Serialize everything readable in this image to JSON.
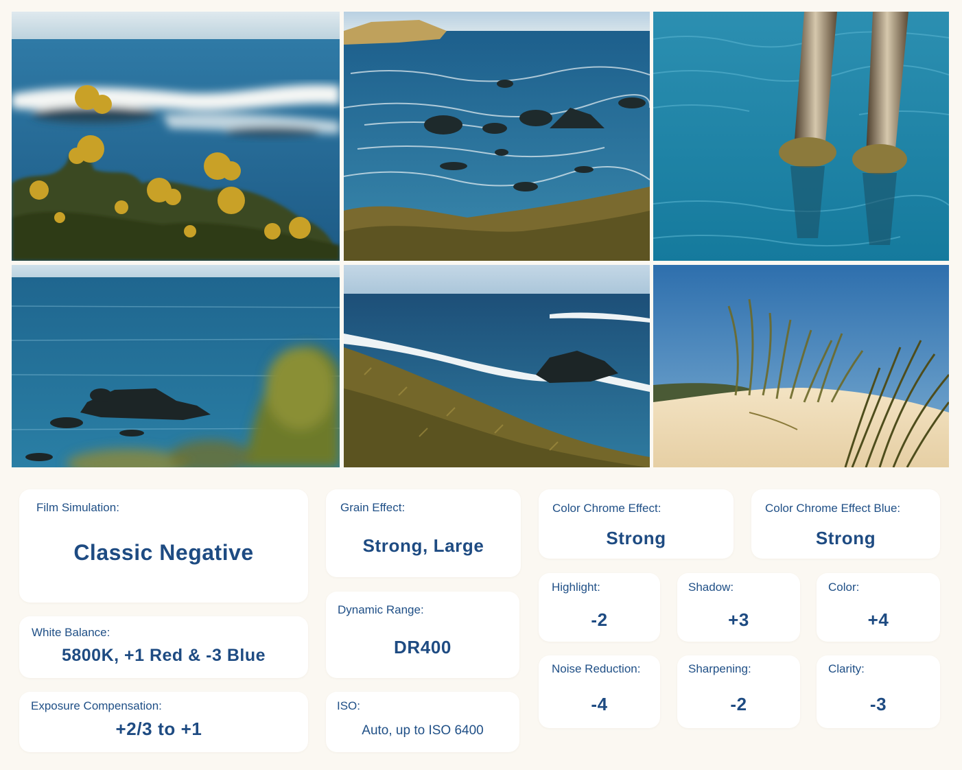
{
  "photos": [
    {
      "name": "photo-yellow-flowers-ocean",
      "alt": ""
    },
    {
      "name": "photo-rocky-coastline",
      "alt": ""
    },
    {
      "name": "photo-pier-pilings-water",
      "alt": ""
    },
    {
      "name": "photo-rocks-blurred-foreground",
      "alt": ""
    },
    {
      "name": "photo-waves-hillside",
      "alt": ""
    },
    {
      "name": "photo-dune-grass",
      "alt": ""
    }
  ],
  "recipe": {
    "film_simulation": {
      "label": "Film Simulation:",
      "value": "Classic Negative"
    },
    "grain_effect": {
      "label": "Grain Effect:",
      "value": "Strong, Large"
    },
    "color_chrome_effect": {
      "label": "Color Chrome Effect:",
      "value": "Strong"
    },
    "color_chrome_effect_blue": {
      "label": "Color Chrome Effect Blue:",
      "value": "Strong"
    },
    "white_balance": {
      "label": "White Balance:",
      "value": "5800K, +1 Red & -3 Blue"
    },
    "dynamic_range": {
      "label": "Dynamic Range:",
      "value": "DR400"
    },
    "highlight": {
      "label": "Highlight:",
      "value": "-2"
    },
    "shadow": {
      "label": "Shadow:",
      "value": "+3"
    },
    "color": {
      "label": "Color:",
      "value": "+4"
    },
    "noise_reduction": {
      "label": "Noise Reduction:",
      "value": "-4"
    },
    "sharpening": {
      "label": "Sharpening:",
      "value": "-2"
    },
    "clarity": {
      "label": "Clarity:",
      "value": "-3"
    },
    "exposure_compensation": {
      "label": "Exposure Compensation:",
      "value": "+2/3 to +1"
    },
    "iso": {
      "label": "ISO:",
      "value": "Auto, up to ISO 6400"
    }
  },
  "colors": {
    "background": "#fbf8f2",
    "card": "#ffffff",
    "text": "#1e4b82"
  }
}
